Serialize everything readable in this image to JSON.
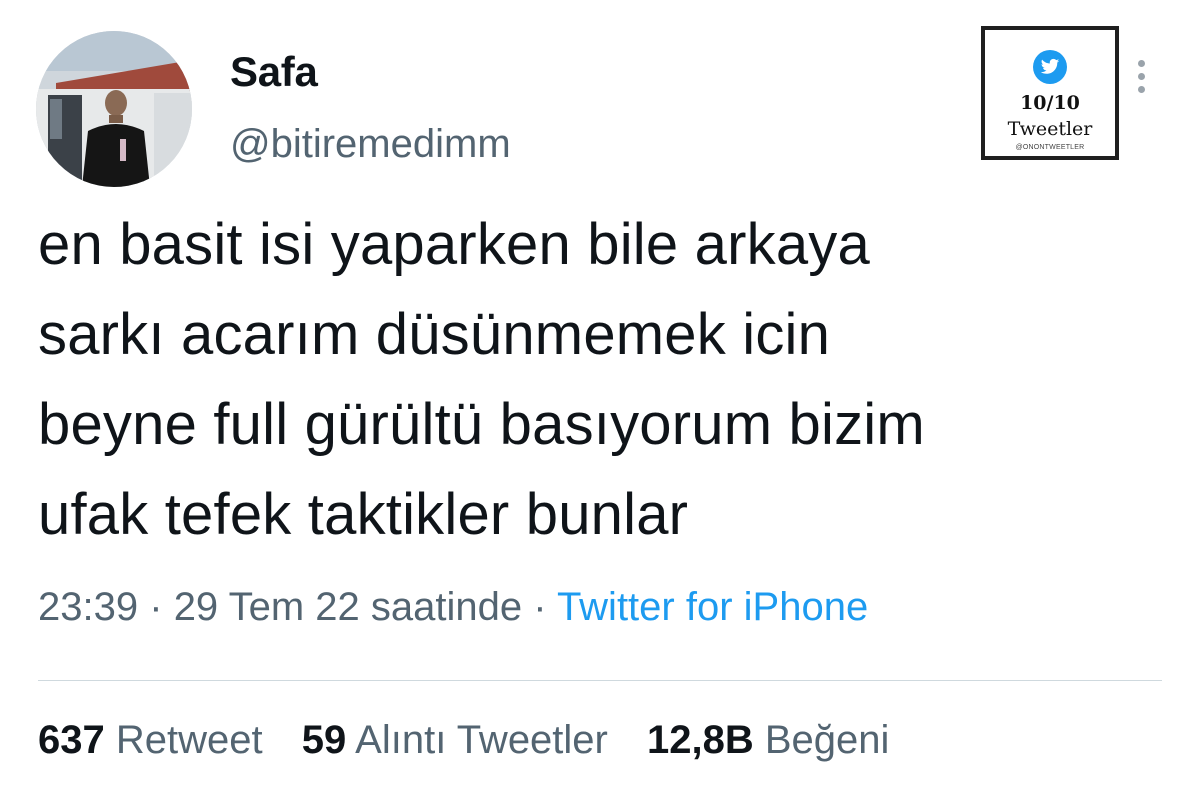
{
  "user": {
    "display_name": "Safa",
    "handle": "@bitiremedimm",
    "avatar_icon": "profile-photo"
  },
  "badge": {
    "icon": "twitter-bird-icon",
    "score": "10/10",
    "label": "Tweetler",
    "credit": "@ONONTWEETLER"
  },
  "more_icon": "vertical-ellipsis-icon",
  "tweet": {
    "lines": [
      "en basit isi yaparken bile arkaya",
      "sarkı acarım düsünmemek icin",
      "beyne full gürültü basıyorum bizim",
      "ufak tefek taktikler bunlar"
    ]
  },
  "meta": {
    "time": "23:39",
    "separator": "·",
    "date": "29 Tem 22 saatinde",
    "source": "Twitter for iPhone"
  },
  "stats": {
    "retweets_count": "637",
    "retweets_label": "Retweet",
    "quotes_count": "59",
    "quotes_label": "Alıntı Tweetler",
    "likes_count": "12,8B",
    "likes_label": "Beğeni"
  },
  "colors": {
    "text": "#0f1419",
    "secondary": "#536471",
    "link": "#1d9bf0",
    "divider": "#cfd9de"
  }
}
